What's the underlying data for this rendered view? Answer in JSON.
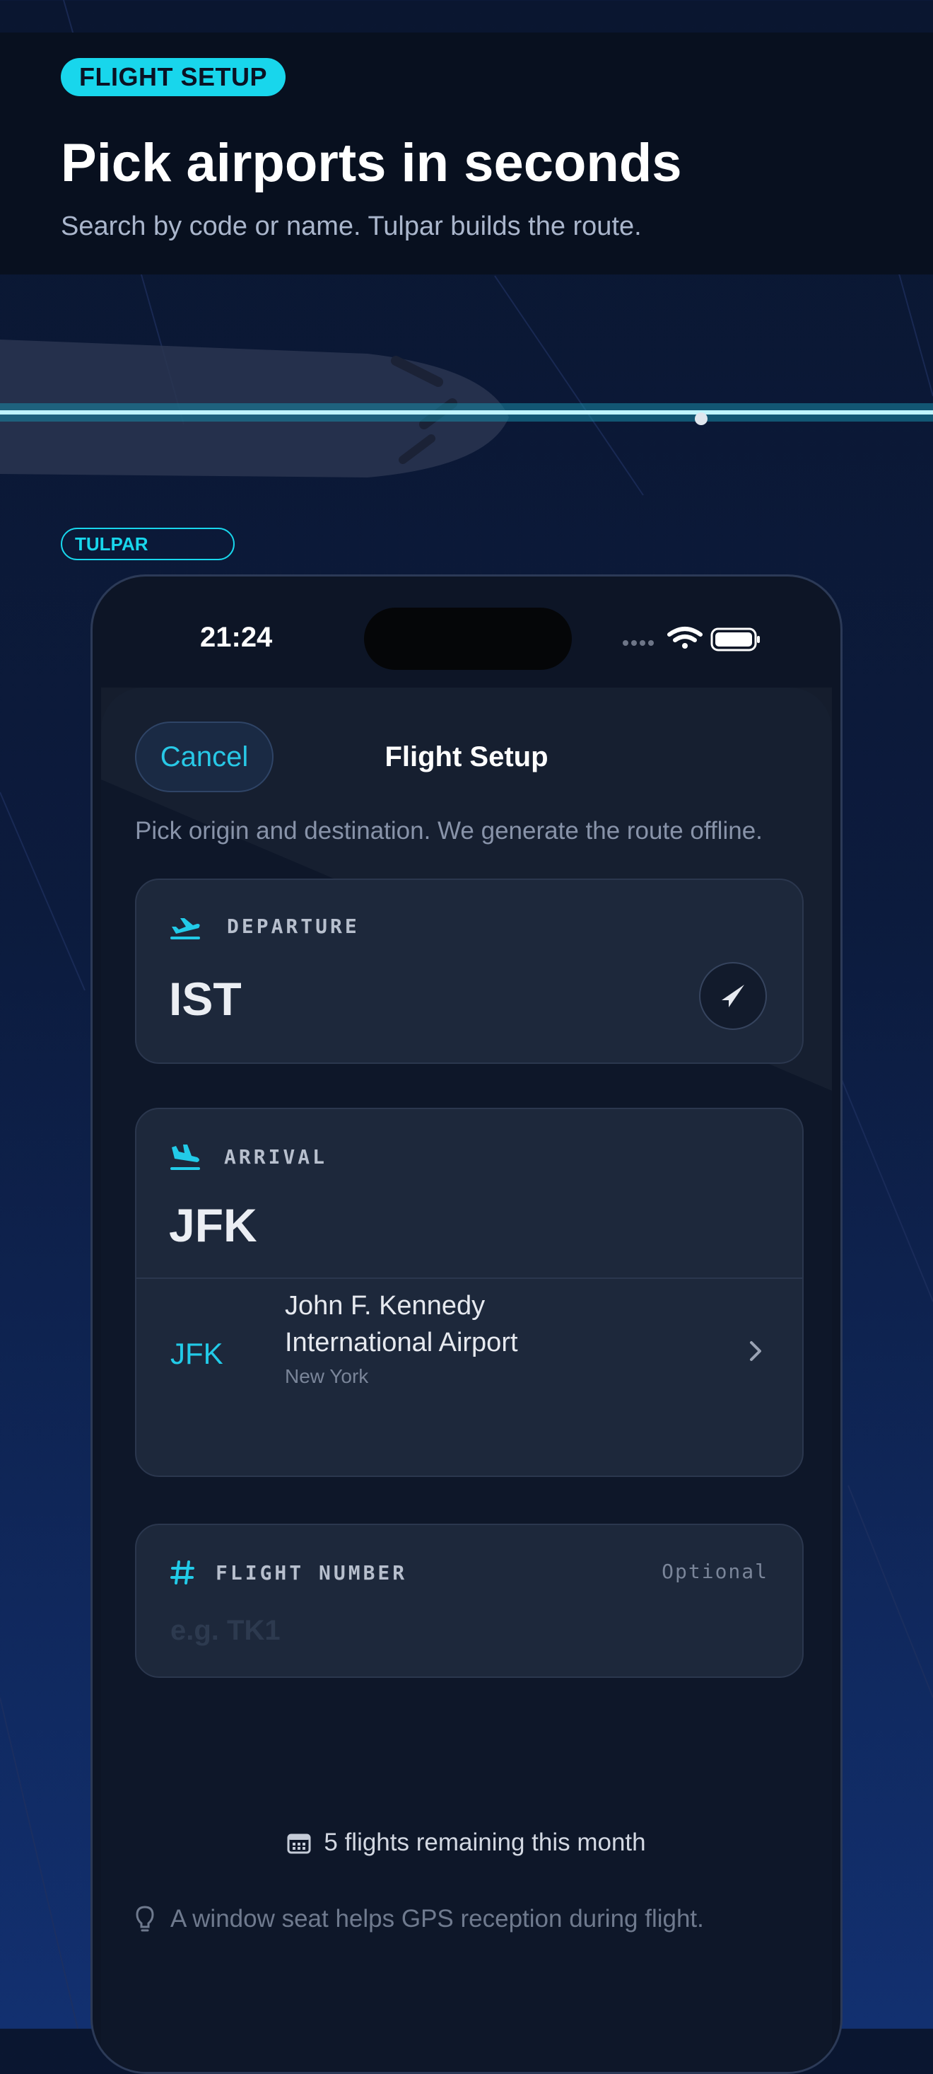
{
  "hero": {
    "tag": "FLIGHT SETUP",
    "title": "Pick airports in seconds",
    "subtitle": "Search by code or name. Tulpar builds the route."
  },
  "brand": {
    "tag": "TULPAR"
  },
  "status_bar": {
    "time": "21:24"
  },
  "sheet": {
    "cancel_label": "Cancel",
    "title": "Flight Setup",
    "description": "Pick origin and destination. We generate the route offline."
  },
  "departure": {
    "label": "DEPARTURE",
    "code": "IST",
    "icon": "plane-takeoff-icon"
  },
  "arrival": {
    "label": "ARRIVAL",
    "code": "JFK",
    "icon": "plane-landing-icon",
    "result": {
      "code": "JFK",
      "name_line1": "John F. Kennedy",
      "name_line2": "International Airport",
      "city": "New York"
    }
  },
  "flight_number": {
    "label": "FLIGHT NUMBER",
    "optional_label": "Optional",
    "placeholder": "e.g. TK1",
    "value": ""
  },
  "remaining": {
    "text": "5 flights remaining this month"
  },
  "tip": {
    "text": "A window seat helps GPS reception during flight."
  },
  "colors": {
    "accent": "#18d6ec",
    "background": "#0c1b3d",
    "card": "#1d283b"
  }
}
